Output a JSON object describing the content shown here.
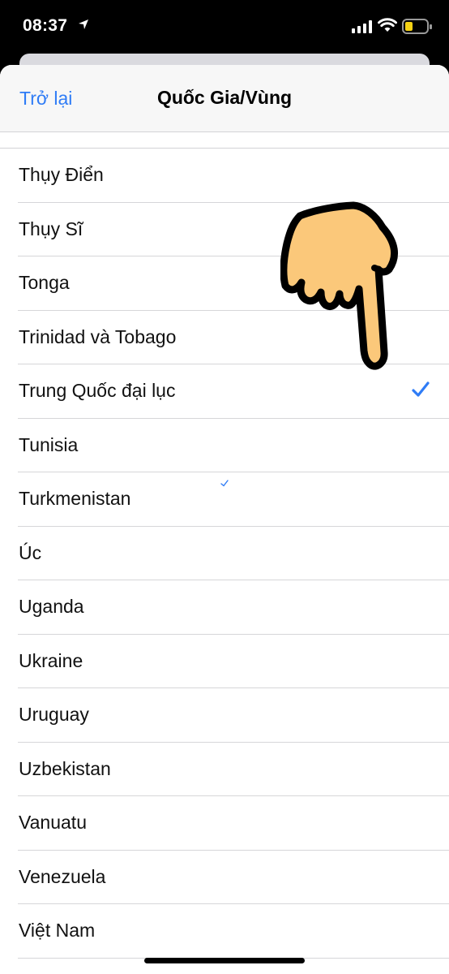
{
  "status_bar": {
    "time": "08:37",
    "icons": [
      "location-arrow-icon",
      "signal-bars-icon",
      "wifi-icon",
      "battery-low-icon"
    ],
    "battery_color": "#f5d214"
  },
  "nav": {
    "back_label": "Trở lại",
    "title": "Quốc Gia/Vùng"
  },
  "accent_color": "#2f7cf6",
  "list": {
    "items": [
      {
        "label": "Thụy Điển",
        "selected": false
      },
      {
        "label": "Thụy Sĩ",
        "selected": false
      },
      {
        "label": "Tonga",
        "selected": false
      },
      {
        "label": "Trinidad và Tobago",
        "selected": false
      },
      {
        "label": "Trung Quốc đại lục",
        "selected": true
      },
      {
        "label": "Tunisia",
        "selected": false
      },
      {
        "label": "Turkmenistan",
        "selected": false
      },
      {
        "label": "Úc",
        "selected": false
      },
      {
        "label": "Uganda",
        "selected": false
      },
      {
        "label": "Ukraine",
        "selected": false
      },
      {
        "label": "Uruguay",
        "selected": false
      },
      {
        "label": "Uzbekistan",
        "selected": false
      },
      {
        "label": "Vanuatu",
        "selected": false
      },
      {
        "label": "Venezuela",
        "selected": false
      },
      {
        "label": "Việt Nam",
        "selected": false
      }
    ]
  },
  "overlay": {
    "icon": "pointing-hand-icon",
    "fill_color": "#fbc87a"
  }
}
